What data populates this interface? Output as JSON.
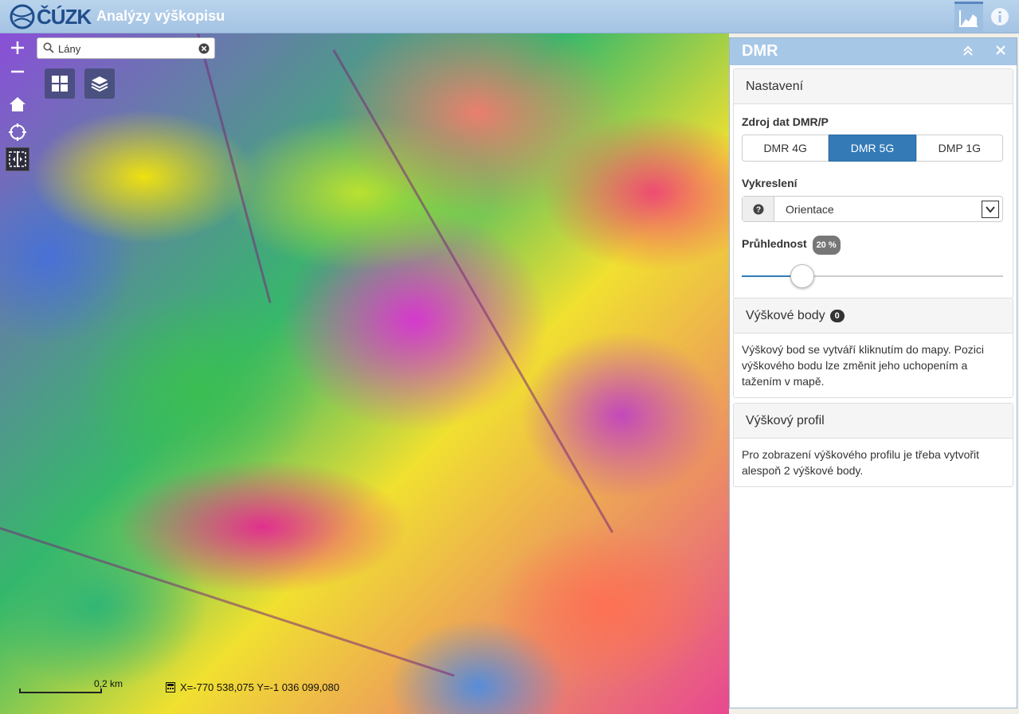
{
  "header": {
    "logo_text": "ČÚZK",
    "app_title": "Analýzy výškopisu"
  },
  "search": {
    "value": "Lány",
    "placeholder": ""
  },
  "map": {
    "scale_label": "0,2 km",
    "coordinates": "X=-770 538,075  Y=-1 036 099,080"
  },
  "panel": {
    "title": "DMR",
    "settings": {
      "heading": "Nastavení",
      "source_label": "Zdroj dat DMR/P",
      "sources": [
        "DMR 4G",
        "DMR 5G",
        "DMP 1G"
      ],
      "selected_source": "DMR 5G",
      "render_label": "Vykreslení",
      "render_value": "Orientace",
      "opacity_label": "Průhlednost",
      "opacity_badge": "20 %",
      "opacity_value": 0.2
    },
    "points": {
      "heading": "Výškové body",
      "count": "0",
      "text": "Výškový bod se vytváří kliknutím do mapy. Pozici výškového bodu lze změnit jeho uchopením a tažením v mapě."
    },
    "profile": {
      "heading": "Výškový profil",
      "text": "Pro zobrazení výškového profilu je třeba vytvořit alespoň 2 výškové body."
    }
  },
  "colors": {
    "header_bg": "#a4c3e3",
    "primary": "#337ab7"
  }
}
